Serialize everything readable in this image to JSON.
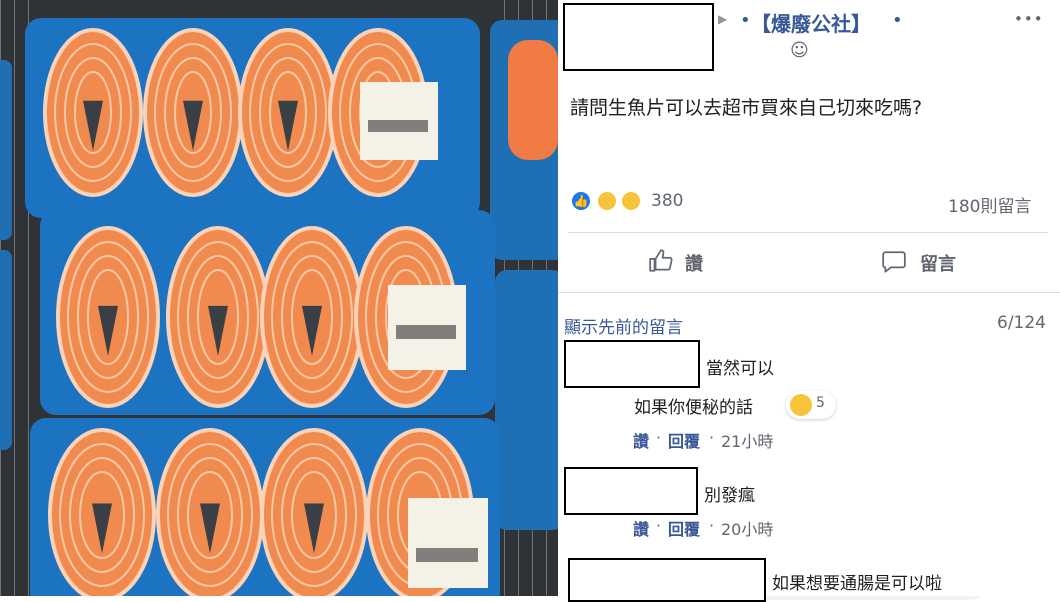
{
  "post": {
    "dot_left": "•",
    "group_name": "【爆廢公社】",
    "dot_right": "•",
    "more": "•••",
    "privacy": "☺",
    "text": "請問生魚片可以去超市買來自己切來吃嗎?",
    "reaction_count": "380",
    "comment_count": "180則留言",
    "like_label": "讚",
    "comment_label": "留言"
  },
  "comments_bar": {
    "show_previous": "顯示先前的留言",
    "counter": "6/124"
  },
  "comments": [
    {
      "lines": [
        "當然可以",
        "如果你便秘的話"
      ],
      "reaction_count": "5",
      "like": "讚",
      "reply": "回覆",
      "sep": "·",
      "time": "21小時"
    },
    {
      "lines": [
        "別發瘋"
      ],
      "like": "讚",
      "reply": "回覆",
      "sep": "·",
      "time": "20小時"
    },
    {
      "lines": [
        "如果想要通腸是可以啦"
      ]
    }
  ],
  "colors": {
    "link_blue": "#385898",
    "like_blue": "#1877f2",
    "text_gray": "#606770"
  },
  "icons": [
    "caret-right-icon",
    "privacy-friends-icon",
    "more-icon",
    "like-reaction-icon",
    "haha-reaction-icon",
    "wow-reaction-icon",
    "thumb-up-icon",
    "comment-icon"
  ]
}
